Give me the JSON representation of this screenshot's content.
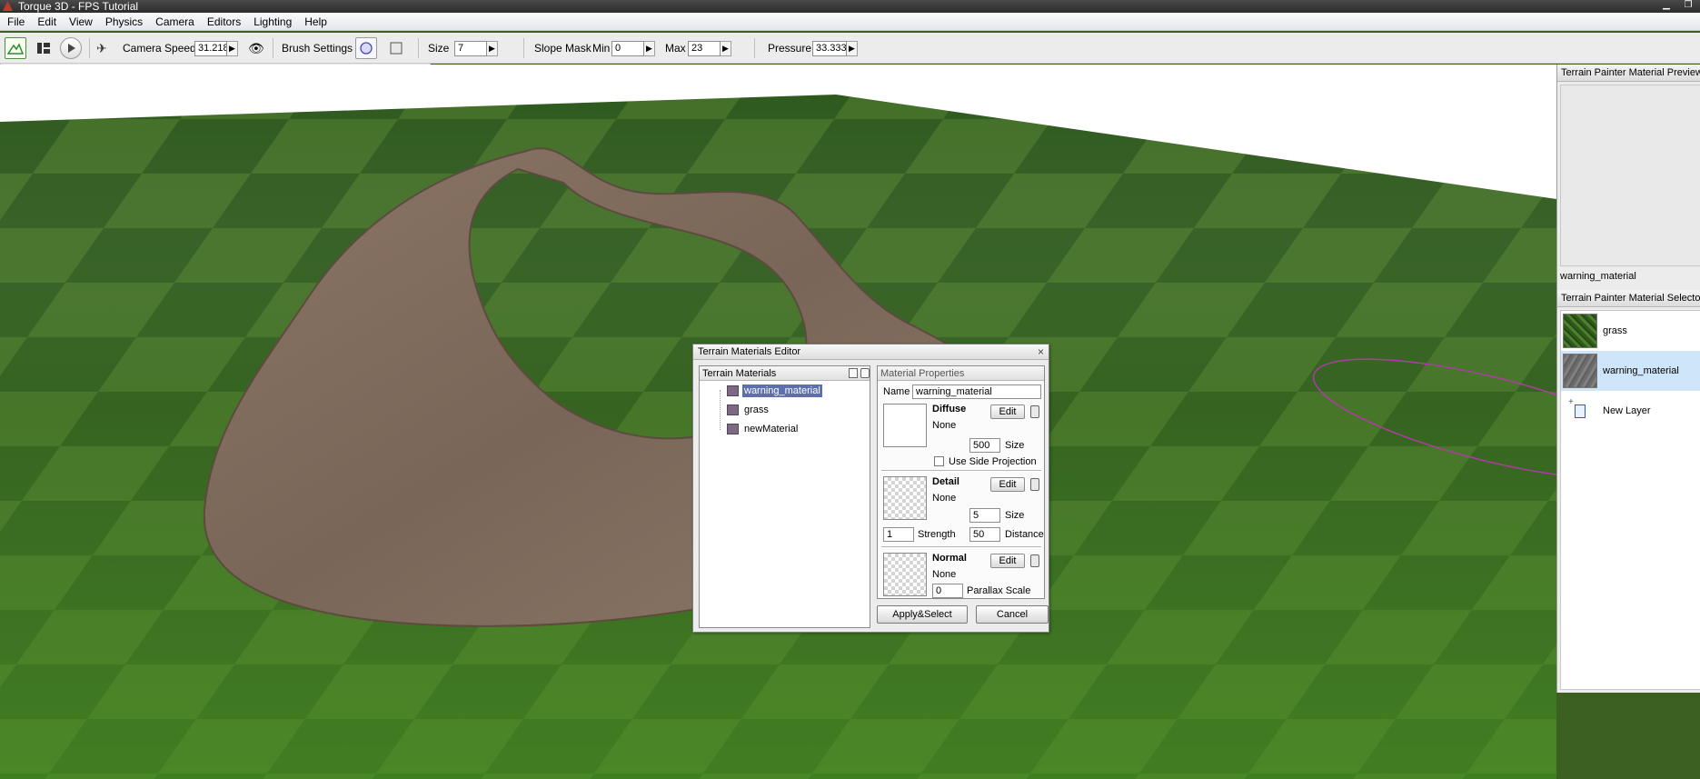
{
  "window": {
    "title": "Torque 3D - FPS Tutorial",
    "minimize": "▁",
    "maximize": "❐"
  },
  "menu": [
    "File",
    "Edit",
    "View",
    "Physics",
    "Camera",
    "Editors",
    "Lighting",
    "Help"
  ],
  "toolbar": {
    "camera_speed_label": "Camera Speed",
    "camera_speed_value": "31.218",
    "brush_settings_label": "Brush Settings",
    "size_label": "Size",
    "size_value": "7",
    "slope_mask_label": "Slope Mask",
    "min_label": "Min",
    "min_value": "0",
    "max_label": "Max",
    "max_value": "23",
    "pressure_label": "Pressure",
    "pressure_value": "33.333"
  },
  "right_panel": {
    "preview_header": "Terrain Painter Material Preview",
    "preview_name": "warning_material",
    "selector_header": "Terrain Painter Material Selector",
    "materials": [
      {
        "name": "grass"
      },
      {
        "name": "warning_material",
        "selected": true
      }
    ],
    "new_layer_label": "New Layer"
  },
  "dialog": {
    "title": "Terrain Materials Editor",
    "close": "×",
    "materials_header": "Terrain Materials",
    "materials": [
      "warning_material",
      "grass",
      "newMaterial"
    ],
    "selected_material": "warning_material",
    "properties_header": "Material Properties",
    "name_label": "Name",
    "name_value": "warning_material",
    "diffuse": {
      "label": "Diffuse",
      "edit": "Edit",
      "texture": "None",
      "size_value": "500",
      "size_label": "Size",
      "side_projection_label": "Use Side Projection"
    },
    "detail": {
      "label": "Detail",
      "edit": "Edit",
      "texture": "None",
      "size_value": "5",
      "size_label": "Size",
      "strength_value": "1",
      "strength_label": "Strength",
      "distance_value": "50",
      "distance_label": "Distance"
    },
    "normal": {
      "label": "Normal",
      "edit": "Edit",
      "texture": "None",
      "parallax_value": "0",
      "parallax_label": "Parallax Scale"
    },
    "apply_button": "Apply&Select",
    "cancel_button": "Cancel"
  }
}
